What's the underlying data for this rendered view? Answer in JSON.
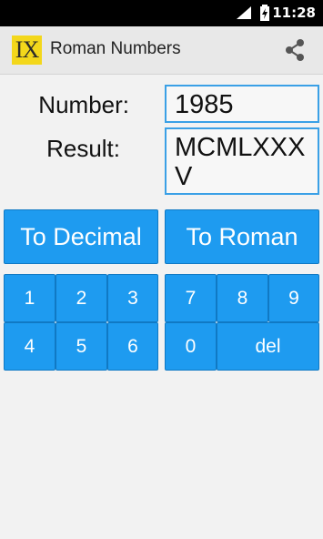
{
  "status_bar": {
    "time": "11:28"
  },
  "app": {
    "icon_text": "IX",
    "title": "Roman Numbers"
  },
  "form": {
    "number_label": "Number:",
    "number_value": "1985",
    "result_label": "Result:",
    "result_value": "MCMLXXXV"
  },
  "actions": {
    "to_decimal": "To Decimal",
    "to_roman": "To Roman"
  },
  "keypad": {
    "k1": "1",
    "k2": "2",
    "k3": "3",
    "k4": "4",
    "k5": "5",
    "k6": "6",
    "k7": "7",
    "k8": "8",
    "k9": "9",
    "k0": "0",
    "del": "del"
  },
  "colors": {
    "accent": "#1e9bf0",
    "field_border": "#3aa0e6",
    "icon_bg": "#f3d71b"
  }
}
